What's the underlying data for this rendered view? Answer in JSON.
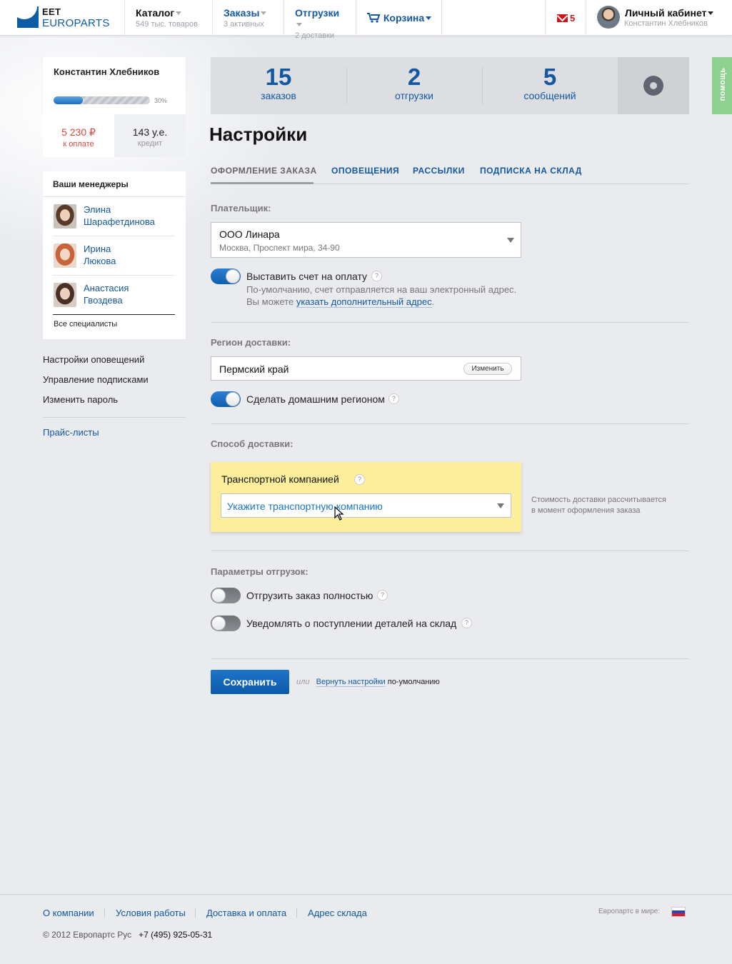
{
  "header": {
    "logo_top": "EET",
    "logo_bottom": "EUROPARTS",
    "nav": [
      {
        "label": "Каталог",
        "sub": "549 тыс. товаров"
      },
      {
        "label": "Заказы",
        "sub": "3 активных"
      },
      {
        "label": "Отгрузки",
        "sub": "2 доставки"
      }
    ],
    "cart_label": "Корзина",
    "mail_count": "5",
    "account_label": "Личный кабинет",
    "account_user": "Константин Хлебников"
  },
  "help_label": "помощь",
  "profile": {
    "name": "Константин Хлебников",
    "progress_percent": 30,
    "progress_label": "30%"
  },
  "balance": {
    "pay_value": "5 230 ₽",
    "pay_label": "к оплате",
    "credit_value": "143 у.е.",
    "credit_label": "кредит"
  },
  "managers": {
    "title": "Ваши менеджеры",
    "items": [
      {
        "first": "Элина",
        "last": "Шарафетдинова"
      },
      {
        "first": "Ирина",
        "last": "Люкова"
      },
      {
        "first": "Анастасия",
        "last": "Гвоздева"
      }
    ],
    "all_label": "Все специалисты"
  },
  "side_links": [
    "Настройки оповещений",
    "Управление подписками",
    "Изменить пароль"
  ],
  "price_lists": "Прайс-листы",
  "stats": [
    {
      "value": "15",
      "label": "заказов"
    },
    {
      "value": "2",
      "label": "отгрузки"
    },
    {
      "value": "5",
      "label": "сообщений"
    }
  ],
  "page_title": "Настройки",
  "tabs": [
    "ОФОРМЛЕНИЕ ЗАКАЗА",
    "ОПОВЕЩЕНИЯ",
    "РАССЫЛКИ",
    "ПОДПИСКА НА СКЛАД"
  ],
  "payer": {
    "label": "Плательщик:",
    "name": "ООО Линара",
    "address": "Москва, Проспект мира, 34-90",
    "invoice_toggle": "Выставить счет на оплату",
    "invoice_on": true,
    "note_line1": "По-умолчанию, счет отправляется на ваш электронный адрес.",
    "note_prefix": "Вы можете",
    "note_link": "указать дополнительный адрес",
    "note_suffix": "."
  },
  "region": {
    "label": "Регион доставки:",
    "value": "Пермский край",
    "change_button": "Изменить",
    "home_toggle": "Сделать домашним регионом",
    "home_on": true
  },
  "delivery": {
    "label": "Способ доставки:",
    "method": "Транспортной компанией",
    "select_placeholder": "Укажите транспортную компанию",
    "note_line1": "Стоимость доставки рассчитывается",
    "note_line2": "в момент оформления заказа"
  },
  "shipping": {
    "label": "Параметры отгрузок:",
    "full_toggle": "Отгрузить заказ полностью",
    "full_on": false,
    "notify_toggle": "Уведомлять о поступлении деталей на склад",
    "notify_on": false
  },
  "actions": {
    "save": "Сохранить",
    "or": "или",
    "reset_link": "Вернуть настройки",
    "reset_suffix": "по-умолчанию"
  },
  "question_mark": "?",
  "footer": {
    "links": [
      "О компании",
      "Условия работы",
      "Доставка и оплата",
      "Адрес склада"
    ],
    "world_label": "Европартс в мире:",
    "copyright": "© 2012 Европартс Рус",
    "phone": "+7 (495) 925-05-31"
  },
  "colors": {
    "brand_blue": "#1358a0",
    "accent_red": "#e0453a",
    "help_green": "#8fd28f",
    "highlight_yellow": "#fdee9b"
  }
}
